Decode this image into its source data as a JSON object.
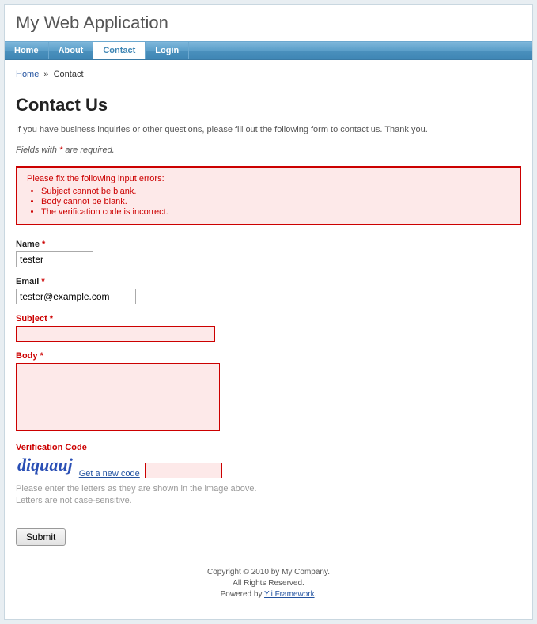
{
  "app_title": "My Web Application",
  "nav": {
    "items": [
      {
        "label": "Home",
        "active": false
      },
      {
        "label": "About",
        "active": false
      },
      {
        "label": "Contact",
        "active": true
      },
      {
        "label": "Login",
        "active": false
      }
    ]
  },
  "breadcrumb": {
    "home": "Home",
    "sep": "»",
    "current": "Contact"
  },
  "page_title": "Contact Us",
  "intro": "If you have business inquiries or other questions, please fill out the following form to contact us. Thank you.",
  "required_note_prefix": "Fields with ",
  "required_note_star": "*",
  "required_note_suffix": " are required.",
  "errors": {
    "heading": "Please fix the following input errors:",
    "items": [
      "Subject cannot be blank.",
      "Body cannot be blank.",
      "The verification code is incorrect."
    ]
  },
  "form": {
    "name": {
      "label": "Name",
      "value": "tester",
      "required": true,
      "error": false
    },
    "email": {
      "label": "Email",
      "value": "tester@example.com",
      "required": true,
      "error": false
    },
    "subject": {
      "label": "Subject",
      "value": "",
      "required": true,
      "error": true
    },
    "body": {
      "label": "Body",
      "value": "",
      "required": true,
      "error": true
    },
    "captcha": {
      "label": "Verification Code",
      "image_text": "diquauj",
      "link": "Get a new code",
      "value": "",
      "error": true,
      "hint1": "Please enter the letters as they are shown in the image above.",
      "hint2": "Letters are not case-sensitive."
    },
    "submit": "Submit"
  },
  "footer": {
    "line1": "Copyright © 2010 by My Company.",
    "line2": "All Rights Reserved.",
    "line3_prefix": "Powered by ",
    "line3_link": "Yii Framework",
    "line3_suffix": "."
  }
}
